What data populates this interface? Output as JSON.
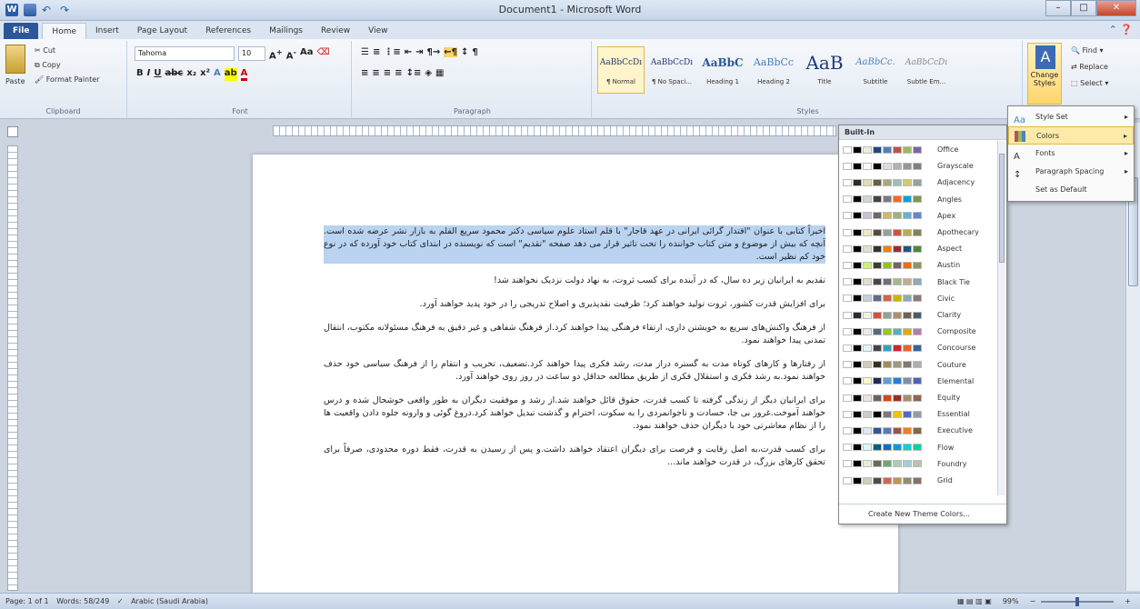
{
  "window": {
    "title": "Document1 - Microsoft Word"
  },
  "tabs": [
    "File",
    "Home",
    "Insert",
    "Page Layout",
    "References",
    "Mailings",
    "Review",
    "View"
  ],
  "clipboard": {
    "paste": "Paste",
    "cut": "Cut",
    "copy": "Copy",
    "format_painter": "Format Painter",
    "label": "Clipboard"
  },
  "font": {
    "name": "Tahoma",
    "size": "10",
    "label": "Font"
  },
  "paragraph": {
    "label": "Paragraph"
  },
  "styles": {
    "label": "Styles",
    "items": [
      {
        "sample": "AaBbCcDı",
        "name": "¶ Normal"
      },
      {
        "sample": "AaBbCcDı",
        "name": "¶ No Spaci..."
      },
      {
        "sample": "AaBbC",
        "name": "Heading 1"
      },
      {
        "sample": "AaBbCc",
        "name": "Heading 2"
      },
      {
        "sample": "AaB",
        "name": "Title"
      },
      {
        "sample": "AaBbCc.",
        "name": "Subtitle"
      },
      {
        "sample": "AaBbCcDı",
        "name": "Subtle Em..."
      }
    ],
    "change_styles": "Change Styles"
  },
  "editing": {
    "find": "Find",
    "replace": "Replace",
    "select": "Select"
  },
  "change_styles_menu": [
    "Style Set",
    "Colors",
    "Fonts",
    "Paragraph Spacing",
    "Set as Default"
  ],
  "themes": {
    "header": "Built-In",
    "items": [
      {
        "name": "Office",
        "colors": [
          "#ffffff",
          "#000000",
          "#eeece1",
          "#1f497d",
          "#4f81bd",
          "#c0504d",
          "#9bbb59",
          "#8064a2"
        ]
      },
      {
        "name": "Grayscale",
        "colors": [
          "#ffffff",
          "#000000",
          "#f8f8f8",
          "#000000",
          "#dddddd",
          "#b2b2b2",
          "#969696",
          "#808080"
        ]
      },
      {
        "name": "Adjacency",
        "colors": [
          "#ffffff",
          "#2f2b20",
          "#dfdcb7",
          "#675e47",
          "#a9a57c",
          "#9cbebd",
          "#d2cb6c",
          "#95a39d"
        ]
      },
      {
        "name": "Angles",
        "colors": [
          "#ffffff",
          "#000000",
          "#cdd7d9",
          "#434342",
          "#797b7e",
          "#f96a1b",
          "#08a1d9",
          "#7c984a"
        ]
      },
      {
        "name": "Apex",
        "colors": [
          "#ffffff",
          "#000000",
          "#c9c2d1",
          "#69676d",
          "#ceb966",
          "#9cb084",
          "#6bb1c9",
          "#6585cf"
        ]
      },
      {
        "name": "Apothecary",
        "colors": [
          "#ffffff",
          "#000000",
          "#ece9c6",
          "#564b3c",
          "#93a299",
          "#cf543f",
          "#b5ae53",
          "#848058"
        ]
      },
      {
        "name": "Aspect",
        "colors": [
          "#ffffff",
          "#000000",
          "#e3ded1",
          "#323232",
          "#f07f09",
          "#9f2936",
          "#1b587c",
          "#4e8542"
        ]
      },
      {
        "name": "Austin",
        "colors": [
          "#ffffff",
          "#000000",
          "#caf278",
          "#3e3d2d",
          "#94c600",
          "#71685a",
          "#ff6700",
          "#909465"
        ]
      },
      {
        "name": "Black Tie",
        "colors": [
          "#ffffff",
          "#000000",
          "#e3dccf",
          "#46464a",
          "#6f6f74",
          "#a7b789",
          "#beae98",
          "#92a9b9"
        ]
      },
      {
        "name": "Civic",
        "colors": [
          "#ffffff",
          "#000000",
          "#c5d1d7",
          "#646b86",
          "#d16349",
          "#ccb400",
          "#8cadae",
          "#8c7b70"
        ]
      },
      {
        "name": "Clarity",
        "colors": [
          "#ffffff",
          "#292934",
          "#f3f2dc",
          "#d2533c",
          "#93a299",
          "#ad8f67",
          "#726056",
          "#4c5a6a"
        ]
      },
      {
        "name": "Composite",
        "colors": [
          "#ffffff",
          "#000000",
          "#e7ece8",
          "#5b6973",
          "#98c723",
          "#59b0b9",
          "#deae00",
          "#b77bb4"
        ]
      },
      {
        "name": "Concourse",
        "colors": [
          "#ffffff",
          "#000000",
          "#def5fa",
          "#464646",
          "#2da2bf",
          "#da1f28",
          "#eb641b",
          "#39639d"
        ]
      },
      {
        "name": "Couture",
        "colors": [
          "#ffffff",
          "#000000",
          "#d0ccb9",
          "#37302a",
          "#9e8e5c",
          "#a09781",
          "#85776d",
          "#aeafa9"
        ]
      },
      {
        "name": "Elemental",
        "colors": [
          "#ffffff",
          "#000000",
          "#fafac8",
          "#242852",
          "#629dd1",
          "#297fd5",
          "#7f8fa9",
          "#4a66ac"
        ]
      },
      {
        "name": "Equity",
        "colors": [
          "#ffffff",
          "#000000",
          "#e9e5dc",
          "#696464",
          "#d34817",
          "#9b2d1f",
          "#a28e6a",
          "#956251"
        ]
      },
      {
        "name": "Essential",
        "colors": [
          "#ffffff",
          "#000000",
          "#cccccc",
          "#000000",
          "#7a7a7a",
          "#f5c201",
          "#526db0",
          "#989aac"
        ]
      },
      {
        "name": "Executive",
        "colors": [
          "#ffffff",
          "#000000",
          "#e4e9ef",
          "#2f5897",
          "#6076b4",
          "#9c5252",
          "#e68422",
          "#846648"
        ]
      },
      {
        "name": "Flow",
        "colors": [
          "#ffffff",
          "#000000",
          "#dbf5f9",
          "#04617b",
          "#0f6fc6",
          "#009dd9",
          "#0bd0d9",
          "#10cf9b"
        ]
      },
      {
        "name": "Foundry",
        "colors": [
          "#ffffff",
          "#000000",
          "#eaebde",
          "#676a55",
          "#72a376",
          "#b0ccb0",
          "#a8cdd7",
          "#c0beaf"
        ]
      },
      {
        "name": "Grid",
        "colors": [
          "#ffffff",
          "#000000",
          "#ccd1b9",
          "#534949",
          "#c66951",
          "#bf974d",
          "#928b70",
          "#87706b"
        ]
      }
    ],
    "footer": "Create New Theme Colors..."
  },
  "document": {
    "paragraphs": [
      "اخیراً کتابی با عنوان \"اقتدار گرائی ایرانی در عهد قاجار\" با قلم استاد علوم سیاسی دکتر محمود سریع القلم به بازار نشر عرضه شده است. آنچه که بیش از موضوع و متن کتاب خواننده را تحت تاثیر قرار می دهد صفحه \"تقدیم\" است که نویسنده در ابتدای کتاب خود آورده که در نوع خود کم نظیر است.",
      "تقدیم به ایرانیان زیر ده سال، که در آینده برای کسب ثروت، به نهاد دولت نزدیک نخواهند شد!",
      "برای افزایش قدرت کشور، ثروت تولید خواهند کرد؛ ظرفیت نقدپذیری و اصلاح تدریجی را در خود پدید خواهند آورد.",
      "از فرهنگ واکنش‌های سریع به خویشتن داری، ارتقاء فرهنگی پیدا خواهند کرد.از فرهنگ شفاهی و غیر دقیق به فرهنگ مسئولانه مکتوب، انتقال تمدنی پیدا خواهند نمود.",
      "از رفتارها و کارهای کوتاه مدت به گستره دراز مدت، رشد فکری پیدا خواهند کرد.تضعیف، تخریب و انتقام را از فرهنگ سیاسی خود حذف خواهند نمود.به رشد فکری و استقلال فکری از طریق مطالعه حداقل دو ساعت در روز روی خواهند آورد.",
      "برای ایرانیان دیگر از زندگی گرفته تا کسب قدرت، حقوق قائل خواهند شد.از رشد و موفقیت دیگران به طور واقعی خوشحال شده و درس خواهند آموخت.غرور بی جا، حسادت و ناجوانمردی را به سکوت، احترام و گذشت تبدیل خواهند کرد.دروغ گوئی و وارونه جلوه دادن واقعیت ها را از نظام معاشرتی خود با دیگران حذف خواهند نمود.",
      "برای کسب قدرت،به اصل رقابت و فرصت برای دیگران اعتقاد خواهند داشت.و پس از رسیدن به قدرت، فقط دوره محدودی، صرفاً برای تحقق کارهای بزرگ، در قدرت خواهند ماند..."
    ]
  },
  "status": {
    "page": "Page: 1 of 1",
    "words": "Words: 58/249",
    "language": "Arabic (Saudi Arabia)",
    "zoom": "99%"
  }
}
